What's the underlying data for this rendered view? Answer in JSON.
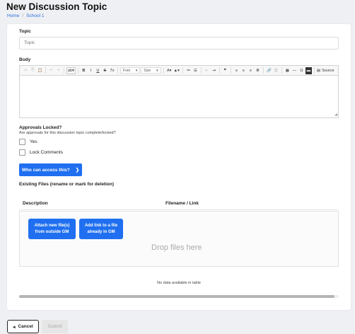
{
  "header": {
    "title": "New Discussion Topic",
    "breadcrumb": [
      "Home",
      "School 1"
    ]
  },
  "form": {
    "topic_label": "Topic",
    "topic_placeholder": "Topic",
    "body_label": "Body",
    "toolbar": {
      "font_label": "Font",
      "size_label": "Size",
      "source_label": "Source"
    },
    "approvals_label": "Approvals Locked?",
    "approvals_question": "Are approvals for this discussion topic complete/locked?",
    "checkbox_yes": "Yes",
    "checkbox_lock": "Lock Comments",
    "access_button": "Who can access this?",
    "existing_files_label": "Existing Files (rename or mark for deletion)",
    "table_headers": [
      "Description",
      "Filename / Link"
    ],
    "attach_button": "Attach new file(s) from outside GM",
    "add_link_button": "Add link to a file already in GM",
    "drop_text": "Drop files here",
    "no_data": "No data available in table"
  },
  "footer": {
    "cancel_label": "Cancel",
    "submit_label": "Submit"
  },
  "colors": {
    "accent": "#1f6ff0",
    "link": "#2a6fe0"
  },
  "icons": [
    "chevron-right-icon",
    "arrow-left-icon",
    "source-icon"
  ]
}
